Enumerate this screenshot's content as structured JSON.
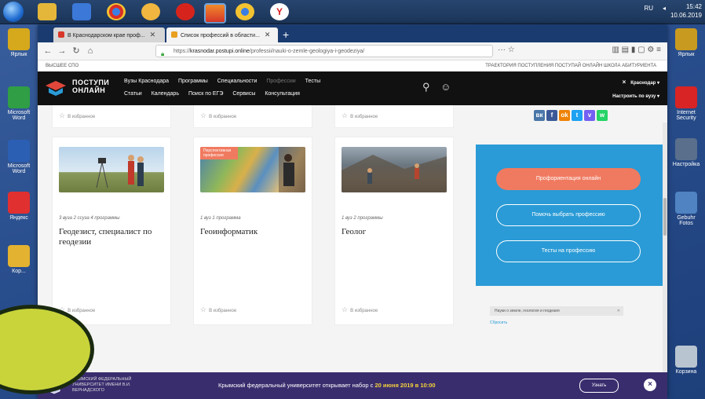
{
  "taskbar": {
    "tray_lang": "RU",
    "time": "15:42",
    "date": "10.06.2019"
  },
  "browser": {
    "tabs": [
      {
        "label": "В Краснодарском крае проф...",
        "active": false,
        "color": "#d8372a"
      },
      {
        "label": "Список профессий в области...",
        "active": true,
        "color": "#e8a020"
      }
    ],
    "url_prefix": "https://",
    "url_host": "krasnodar.postupi.online",
    "url_path": "/professii/nauki-o-zemle-geologiya-i-geodeziya/",
    "url_end": "···  ☆"
  },
  "site": {
    "top_left": "ВЫСШЕЕ   СПО",
    "top_right": "ТРАЕКТОРИЯ ПОСТУПЛЕНИЯ   ПОСТУПАЙ ОНЛАЙН   ШКОЛА АБИТУРИЕНТА",
    "logo_line1": "ПОСТУПИ",
    "logo_line2": "ОНЛАЙН",
    "menu_row1": [
      "Вузы Краснодара",
      "Программы",
      "Специальности",
      "Профессии",
      "Тесты"
    ],
    "menu_row2": [
      "Статьи",
      "Календарь",
      "Поиск по ЕГЭ",
      "Сервисы",
      "Консультация"
    ],
    "city": "Краснодар ▾",
    "setup": "Настроить по вузу ▾",
    "close": "×"
  },
  "cards_top": [
    {
      "fav": "В избранное"
    },
    {
      "fav": "В избранное"
    },
    {
      "fav": "В избранное"
    }
  ],
  "cards": [
    {
      "meta": "3 вуза    2 ссуза    4 программы",
      "title": "Геодезист, специалист по геодезии",
      "fav": "В избранное",
      "badge": ""
    },
    {
      "meta": "1 вуз    1 программа",
      "title": "Геоинформатик",
      "fav": "В избранное",
      "badge": "Перспективная профессия"
    },
    {
      "meta": "1 вуз    2 программы",
      "title": "Геолог",
      "fav": "В избранное",
      "badge": ""
    }
  ],
  "sidebar": {
    "share": [
      {
        "label": "вк",
        "color": "#4a76a8"
      },
      {
        "label": "f",
        "color": "#3b5998"
      },
      {
        "label": "ok",
        "color": "#ee8208"
      },
      {
        "label": "t",
        "color": "#1da1f2"
      },
      {
        "label": "v",
        "color": "#7360f2"
      },
      {
        "label": "w",
        "color": "#25d366"
      }
    ],
    "btn_orange": "Профориентация онлайн",
    "btn_help": "Помочь выбрать профессию",
    "btn_tests": "Тесты на профессию",
    "chip": "Науки о земле, геология и геодезия",
    "reset": "Сбросить"
  },
  "banner": {
    "uni": [
      "КРЫМСКИЙ ФЕДЕРАЛЬНЫЙ",
      "УНИВЕРСИТЕТ ИМЕНИ В.И.",
      "ВЕРНАДСКОГО"
    ],
    "msg_text": "Крымский федеральный университет открывает набор с ",
    "msg_date": "20 июня 2019 в 10:00",
    "more": "Узнать",
    "close": "×"
  },
  "desktop": {
    "left_labels": [
      "Ярлык",
      "Microsoft Word",
      "Microsoft Word",
      "Яндекс",
      "Кор..."
    ],
    "right_labels": [
      "Ярлык",
      "Internet Security",
      "Настройка",
      "Gebuhr Fotos",
      "Корзина"
    ]
  }
}
